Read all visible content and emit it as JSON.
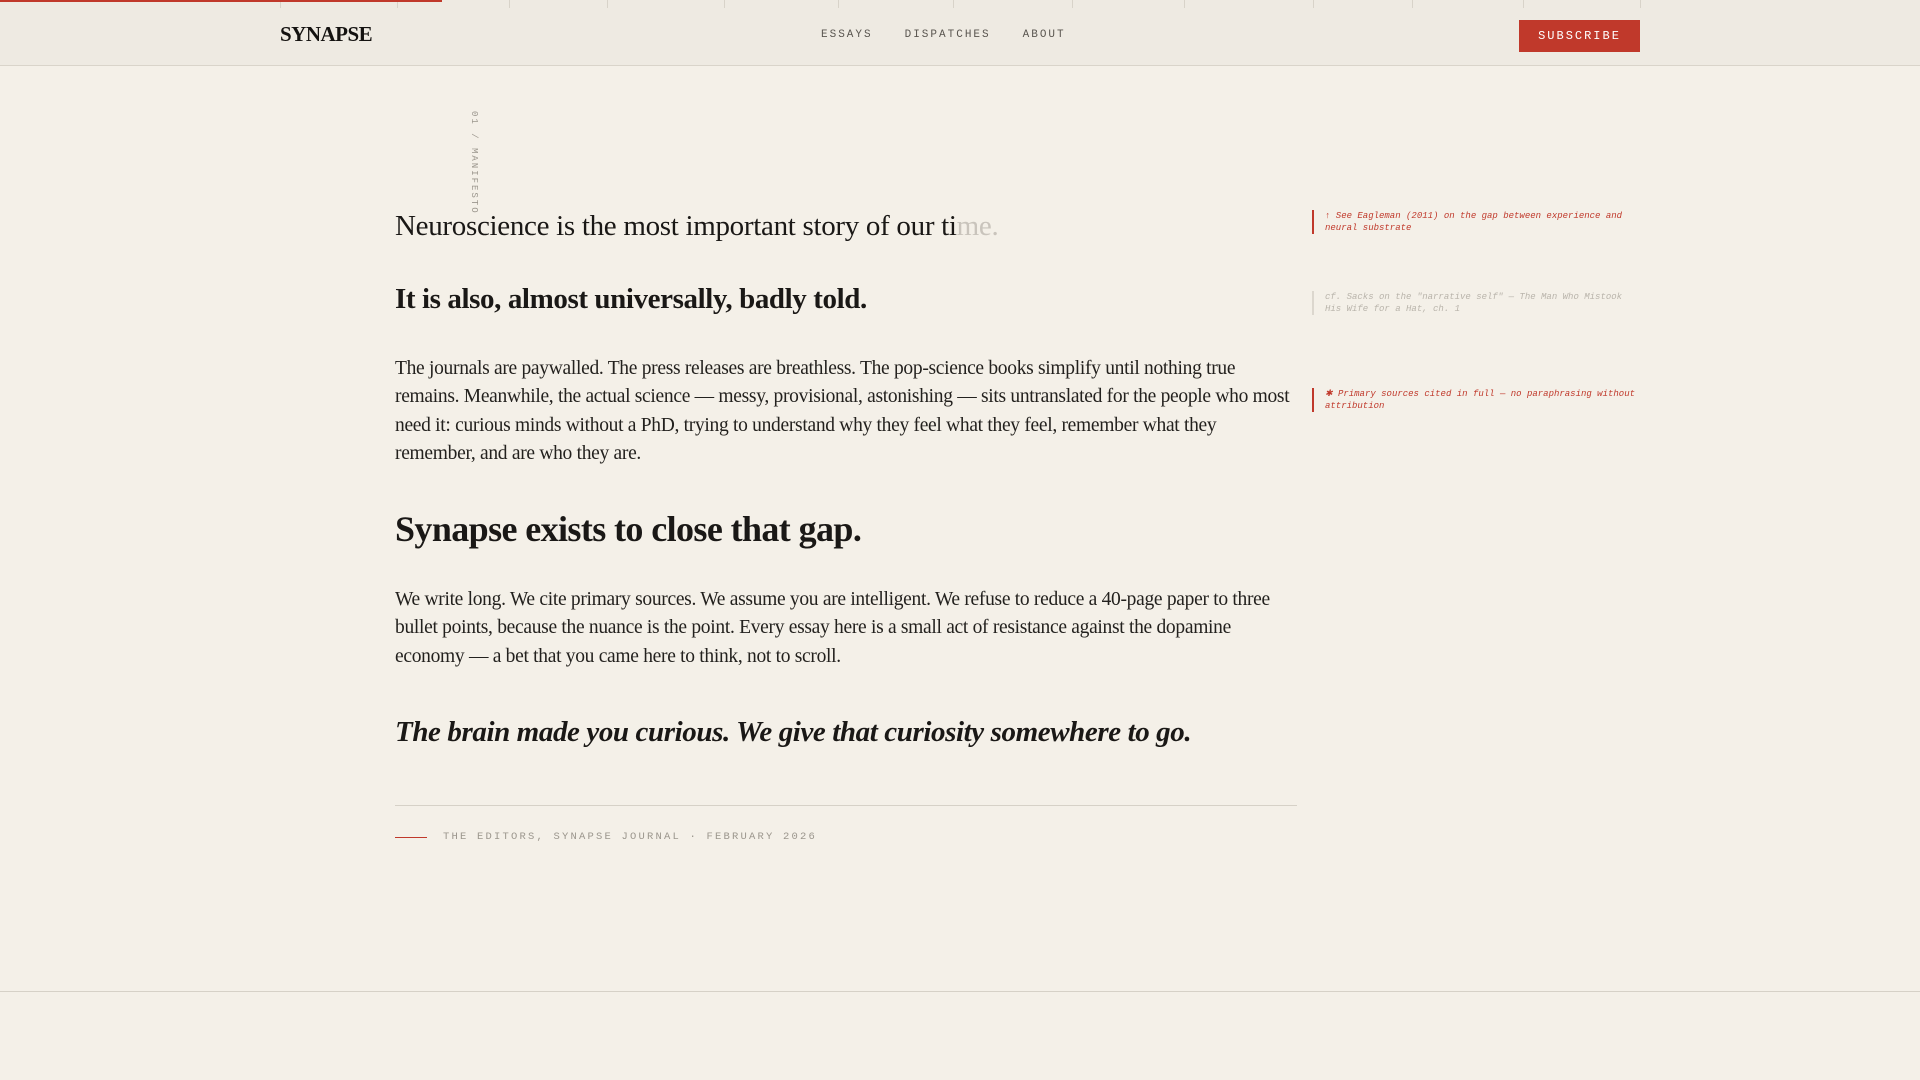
{
  "header": {
    "logo": "SYNAPSE",
    "nav": [
      "ESSAYS",
      "DISPATCHES",
      "ABOUT"
    ],
    "subscribe_label": "SUBSCRIBE"
  },
  "reading_progress": 0.23,
  "section_label": "01 / MANIFESTO",
  "article": {
    "lede_solid": "Neuroscience is the most important story of our ti",
    "lede_fading": "me.",
    "secondary_heading": "It is also, almost universally, badly told.",
    "paragraph_1": "The journals are paywalled. The press releases are breathless. The pop-science books simplify until nothing true remains. Meanwhile, the actual science — messy, provisional, astonishing — sits untranslated for the people who most need it: curious minds without a PhD, trying to understand why they feel what they feel, remember what they remember, and are who they are.",
    "primary_heading": "Synapse exists to close that gap.",
    "paragraph_2": "We write long. We cite primary sources. We assume you are intelligent. We refuse to reduce a 40-page paper to three bullet points, because the nuance is the point. Every essay here is a small act of resistance against the dopamine economy — a bet that you came here to think, not to scroll.",
    "closing_line": "The brain made you curious. We give that curiosity somewhere to go.",
    "signoff": "THE EDITORS, SYNAPSE JOURNAL · FEBRUARY 2026"
  },
  "margin_notes": [
    "↑ See Eagleman (2011) on the gap between experience and neural substrate",
    "cf. Sacks on the \"narrative self\" — The Man Who Mistook His Wife for a Hat, ch. 1",
    "✱ Primary sources cited in full — no paraphrasing without attribution"
  ],
  "colors": {
    "accent": "#c0392b",
    "background": "#f4f0e8",
    "text": "#1a1816"
  }
}
